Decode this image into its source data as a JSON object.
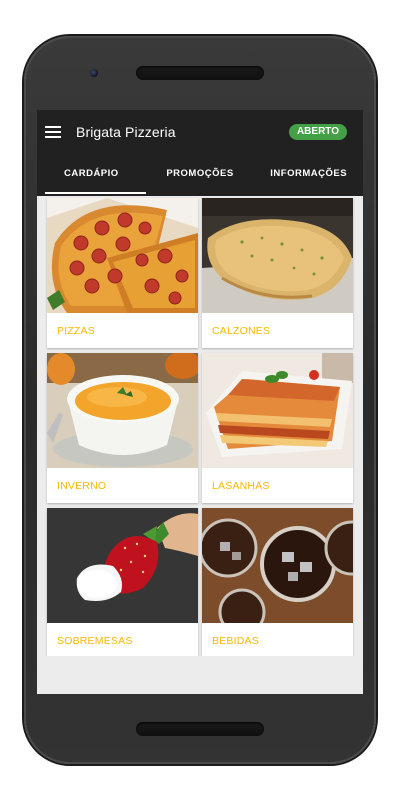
{
  "app": {
    "title": "Brigata Pizzeria",
    "status": "ABERTO",
    "status_color": "#43a047",
    "menu_icon": "hamburger-menu-icon"
  },
  "tabs": [
    {
      "label": "CARDÁPIO",
      "active": true
    },
    {
      "label": "PROMOÇÕES",
      "active": false
    },
    {
      "label": "INFORMAÇÕES",
      "active": false
    }
  ],
  "categories": [
    {
      "label": "PIZZAS",
      "image": "pizza-photo"
    },
    {
      "label": "CALZONES",
      "image": "calzone-photo"
    },
    {
      "label": "INVERNO",
      "image": "soup-photo"
    },
    {
      "label": "LASANHAS",
      "image": "lasagna-photo"
    },
    {
      "label": "SOBREMESAS",
      "image": "chocolate-strawberry-photo"
    },
    {
      "label": "BEBIDAS",
      "image": "drinks-photo"
    }
  ],
  "colors": {
    "appbar": "#212121",
    "label": "#f5b800",
    "background": "#ececec"
  }
}
